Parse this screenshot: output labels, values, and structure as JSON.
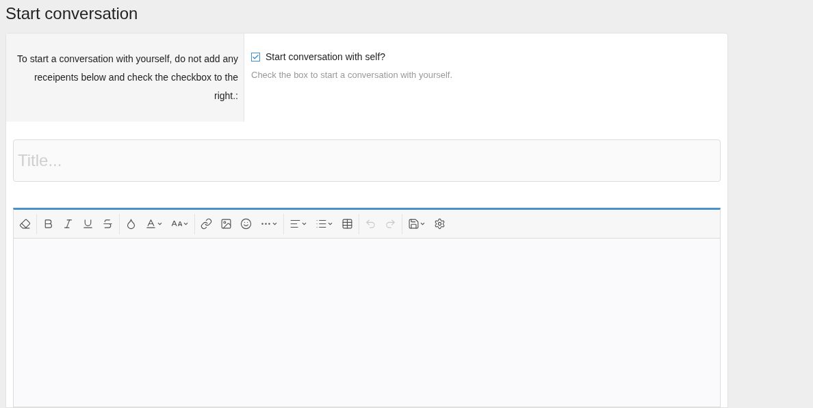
{
  "page_title": "Start conversation",
  "self_conversation": {
    "label": "To start a conversation with yourself, do not add any receipents below and check the checkbox to the right.:",
    "checkbox_label": "Start conversation with self?",
    "checked": true,
    "hint": "Check the box to start a conversation with yourself."
  },
  "title_field": {
    "placeholder": "Title..."
  },
  "editor_toolbar": {
    "undo": {
      "disabled": true
    },
    "redo": {
      "disabled": true
    }
  }
}
